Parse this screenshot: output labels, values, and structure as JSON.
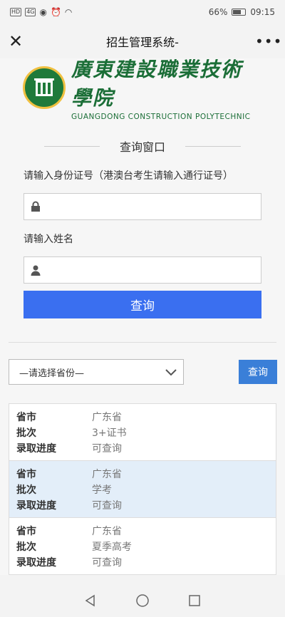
{
  "status": {
    "icons_left": [
      "HD",
      "4G"
    ],
    "battery": "66%",
    "time": "09:15",
    "battery_level": 0.66
  },
  "nav": {
    "title": "招生管理系统-",
    "close": "✕",
    "more": "•••"
  },
  "logo": {
    "cn": "廣東建設職業技術學院",
    "en": "GUANGDONG CONSTRUCTION POLYTECHNIC"
  },
  "query": {
    "title": "查询窗口",
    "id_label": "请输入身份证号（港澳台考生请输入通行证号）",
    "name_label": "请输入姓名",
    "button": "查询"
  },
  "province": {
    "placeholder": "—请选择省份—",
    "button": "查询"
  },
  "results": [
    {
      "province_label": "省市",
      "province": "广东省",
      "batch_label": "批次",
      "batch": "3+证书",
      "progress_label": "录取进度",
      "progress": "可查询"
    },
    {
      "province_label": "省市",
      "province": "广东省",
      "batch_label": "批次",
      "batch": "学考",
      "progress_label": "录取进度",
      "progress": "可查询"
    },
    {
      "province_label": "省市",
      "province": "广东省",
      "batch_label": "批次",
      "batch": "夏季高考",
      "progress_label": "录取进度",
      "progress": "可查询"
    }
  ]
}
